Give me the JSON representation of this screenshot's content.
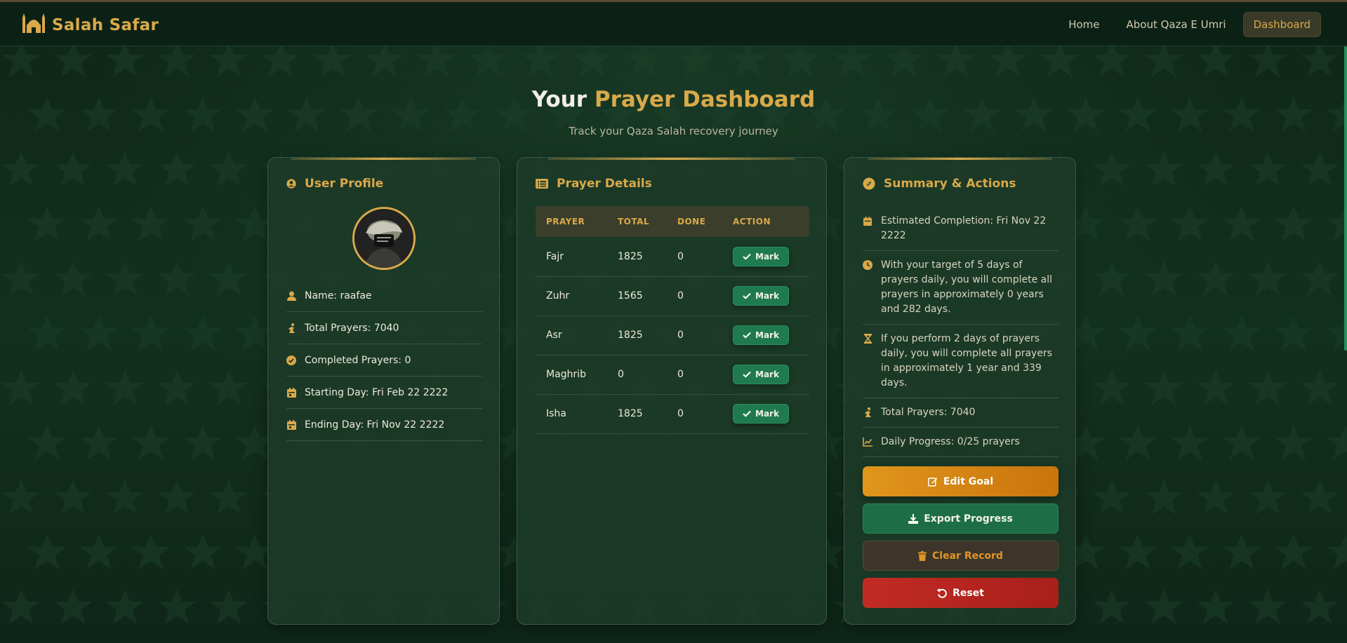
{
  "header": {
    "brand": "Salah Safar",
    "nav": [
      {
        "label": "Home"
      },
      {
        "label": "About Qaza E Umri"
      },
      {
        "label": "Dashboard",
        "active": true
      }
    ]
  },
  "hero": {
    "title_plain": "Your",
    "title_accent": "Prayer Dashboard",
    "subtitle": "Track your Qaza Salah recovery journey"
  },
  "profile": {
    "title": "User Profile",
    "items": [
      {
        "icon": "user-icon",
        "text": "Name: raafae"
      },
      {
        "icon": "praying-person-icon",
        "text": "Total Prayers: 7040"
      },
      {
        "icon": "check-circle-icon",
        "text": "Completed Prayers: 0"
      },
      {
        "icon": "calendar-icon",
        "text": "Starting Day: Fri Feb 22 2222"
      },
      {
        "icon": "calendar-icon",
        "text": "Ending Day: Fri Nov 22 2222"
      }
    ]
  },
  "prayers": {
    "title": "Prayer Details",
    "columns": [
      "PRAYER",
      "TOTAL",
      "DONE",
      "ACTION"
    ],
    "rows": [
      {
        "prayer": "Fajr",
        "total": "1825",
        "done": "0",
        "action": "Mark"
      },
      {
        "prayer": "Zuhr",
        "total": "1565",
        "done": "0",
        "action": "Mark"
      },
      {
        "prayer": "Asr",
        "total": "1825",
        "done": "0",
        "action": "Mark"
      },
      {
        "prayer": "Maghrib",
        "total": "0",
        "done": "0",
        "action": "Mark"
      },
      {
        "prayer": "Isha",
        "total": "1825",
        "done": "0",
        "action": "Mark"
      }
    ]
  },
  "summary": {
    "title": "Summary & Actions",
    "items": [
      {
        "icon": "calendar-icon",
        "text": "Estimated Completion: Fri Nov 22 2222"
      },
      {
        "icon": "clock-icon",
        "text": "With your target of 5 days of prayers daily, you will complete all prayers in approximately 0 years and 282 days."
      },
      {
        "icon": "hourglass-icon",
        "text": "If you perform 2 days of prayers daily, you will complete all prayers in approximately 1 year and 339 days."
      },
      {
        "icon": "praying-person-icon",
        "text": "Total Prayers: 7040"
      },
      {
        "icon": "chart-line-icon",
        "text": "Daily Progress: 0/25 prayers"
      }
    ],
    "actions": {
      "edit": "Edit Goal",
      "export": "Export Progress",
      "clear": "Clear Record",
      "reset": "Reset"
    }
  },
  "colors": {
    "accent_gold": "#d9a94a",
    "background": "#0f2a1c",
    "card": "#1c3a28",
    "mark_green": "#1f7a4f",
    "edit_orange": "#e0961c",
    "reset_red": "#c22b25"
  }
}
